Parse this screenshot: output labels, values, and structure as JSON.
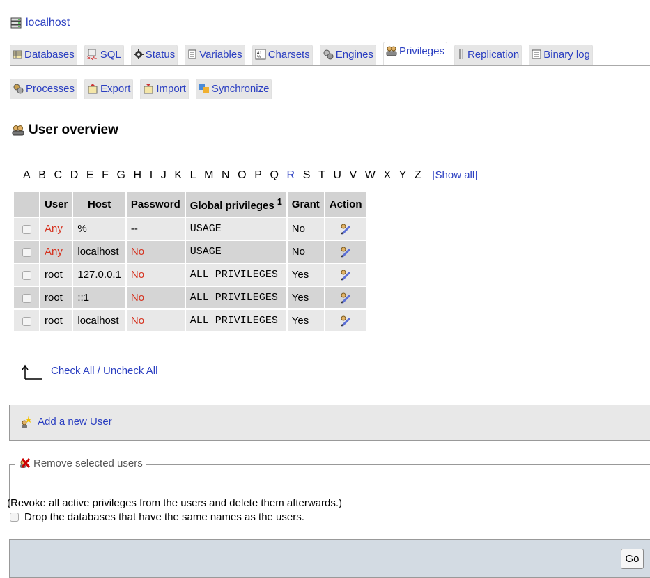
{
  "server": {
    "label": "localhost",
    "icon": "server-icon"
  },
  "tabs_row1": [
    {
      "label": "Databases",
      "icon": "database-icon"
    },
    {
      "label": "SQL",
      "icon": "sql-icon"
    },
    {
      "label": "Status",
      "icon": "status-icon"
    },
    {
      "label": "Variables",
      "icon": "variables-icon"
    },
    {
      "label": "Charsets",
      "icon": "charsets-icon"
    },
    {
      "label": "Engines",
      "icon": "engines-icon"
    },
    {
      "label": "Privileges",
      "icon": "privileges-icon",
      "active": true
    },
    {
      "label": "Replication",
      "icon": "replication-icon"
    },
    {
      "label": "Binary log",
      "icon": "binary-log-icon"
    }
  ],
  "tabs_row2": [
    {
      "label": "Processes",
      "icon": "processes-icon"
    },
    {
      "label": "Export",
      "icon": "export-icon"
    },
    {
      "label": "Import",
      "icon": "import-icon"
    },
    {
      "label": "Synchronize",
      "icon": "synchronize-icon"
    }
  ],
  "page_title": "User overview",
  "alphabet": {
    "letters": [
      "A",
      "B",
      "C",
      "D",
      "E",
      "F",
      "G",
      "H",
      "I",
      "J",
      "K",
      "L",
      "M",
      "N",
      "O",
      "P",
      "Q",
      "R",
      "S",
      "T",
      "U",
      "V",
      "W",
      "X",
      "Y",
      "Z"
    ],
    "linked": [
      "R"
    ],
    "show_all": "[Show all]"
  },
  "table": {
    "headers": [
      "User",
      "Host",
      "Password",
      "Global privileges",
      "Grant",
      "Action"
    ],
    "global_privileges_footnote": "1",
    "rows": [
      {
        "user": "Any",
        "host": "%",
        "password": "--",
        "privileges": "USAGE",
        "grant": "No",
        "user_red": true,
        "password_red": false
      },
      {
        "user": "Any",
        "host": "localhost",
        "password": "No",
        "privileges": "USAGE",
        "grant": "No",
        "user_red": true,
        "password_red": true
      },
      {
        "user": "root",
        "host": "127.0.0.1",
        "password": "No",
        "privileges": "ALL PRIVILEGES",
        "grant": "Yes",
        "user_red": false,
        "password_red": true
      },
      {
        "user": "root",
        "host": "::1",
        "password": "No",
        "privileges": "ALL PRIVILEGES",
        "grant": "Yes",
        "user_red": false,
        "password_red": true
      },
      {
        "user": "root",
        "host": "localhost",
        "password": "No",
        "privileges": "ALL PRIVILEGES",
        "grant": "Yes",
        "user_red": false,
        "password_red": true
      }
    ],
    "action_icon": "edit-privileges-icon"
  },
  "check_all": "Check All / Uncheck All",
  "add_user": "Add a new User",
  "remove": {
    "legend": "Remove selected users",
    "note": "(Revoke all active privileges from the users and delete them afterwards.)",
    "drop_label": "Drop the databases that have the same names as the users."
  },
  "go_button": "Go",
  "colors": {
    "link": "#2b3fc1",
    "negative": "#d5321f",
    "header_bg": "#d2d2d2",
    "footer_bg": "#d3dbe3"
  }
}
